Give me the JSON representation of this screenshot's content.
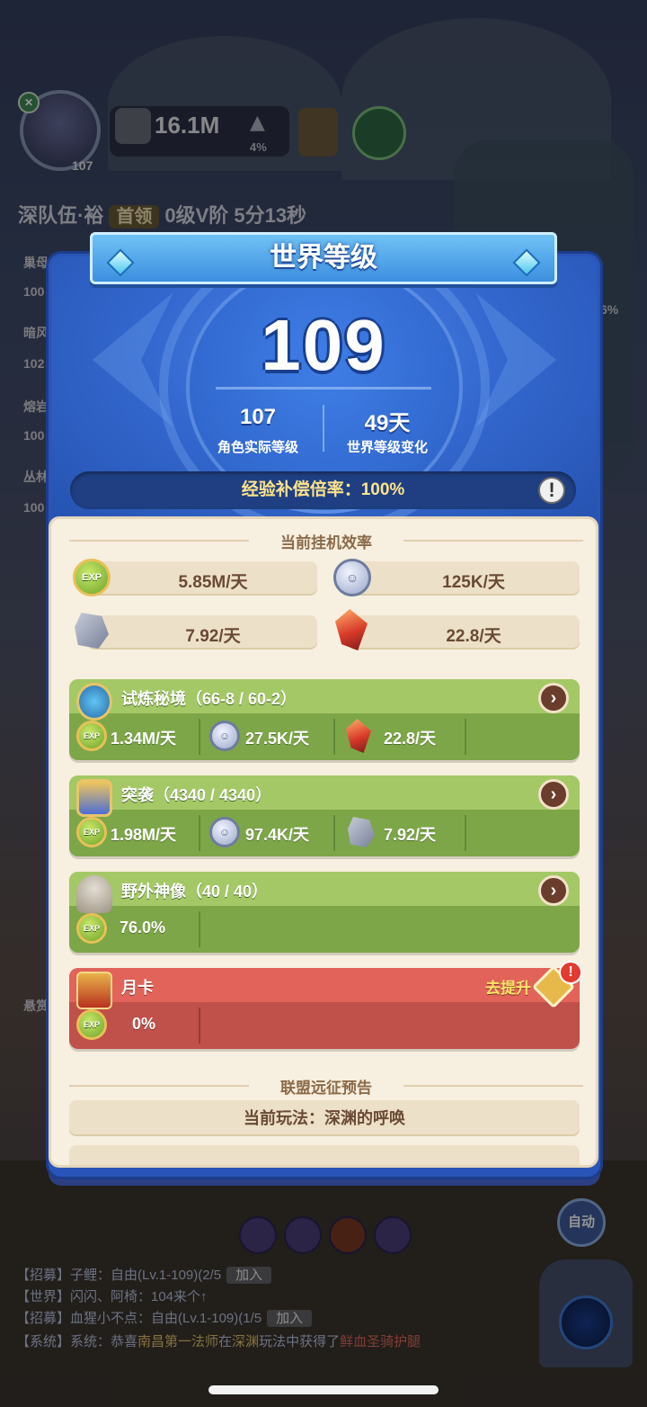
{
  "hud": {
    "avatar_level": "107",
    "power": "16.1M",
    "power_pct": "4%",
    "team_prefix": "深队伍·裕",
    "team_tag": "首领",
    "team_rest": "0级V阶 5分13秒",
    "side_labels": [
      "巢母",
      "100",
      "暗风",
      "102",
      "熔岩",
      "100",
      "丛林",
      "100",
      "悬赏"
    ],
    "side_right": "6%",
    "auto_label": "自动"
  },
  "chat": [
    {
      "prefix": "【招募】子鲤：自由(Lv.1-109)(2/5",
      "join": "加入"
    },
    {
      "prefix": "【世界】闪闪、阿椅：104来个↑",
      "join": ""
    },
    {
      "prefix": "【招募】血猩小不点：自由(Lv.1-109)(1/5",
      "join": "加入"
    },
    {
      "prefix": "【系统】系统：恭喜",
      "gold": "南昌第一法师",
      "mid": "在",
      "gold2": "深渊",
      "mid2": "玩法中获得了",
      "red": "鲜血圣骑护腿"
    }
  ],
  "panel": {
    "title": "世界等级",
    "world_level": "109",
    "char_level": "107",
    "char_level_label": "角色实际等级",
    "days": "49天",
    "days_label": "世界等级变化",
    "compensation": "经验补偿倍率：100%",
    "alert_icon": "!"
  },
  "afk": {
    "title": "当前挂机效率",
    "exp_rate": "5.85M/天",
    "coin_rate": "125K/天",
    "stone_rate": "7.92/天",
    "crystal_rate": "22.8/天"
  },
  "cards": [
    {
      "title": "试炼秘境（66-8 / 60-2）",
      "exp": "1.34M/天",
      "coin": "27.5K/天",
      "third": "22.8/天",
      "third_icon": "crystal-icon"
    },
    {
      "title": "突袭（4340 / 4340）",
      "exp": "1.98M/天",
      "coin": "97.4K/天",
      "third": "7.92/天",
      "third_icon": "stone-icon"
    },
    {
      "title": "野外神像（40 / 40）",
      "exp": "76.0%"
    },
    {
      "title": "月卡",
      "exp": "0%",
      "upgrade": "去提升"
    }
  ],
  "preview": {
    "title": "联盟远征预告",
    "current": "当前玩法：深渊的呼唤"
  },
  "colors": {
    "panel_blue": "#2a55b8",
    "cream": "#f7efdf",
    "green_card": "#7da648",
    "red_card": "#c0504a",
    "gold_text": "#ffe38a"
  }
}
